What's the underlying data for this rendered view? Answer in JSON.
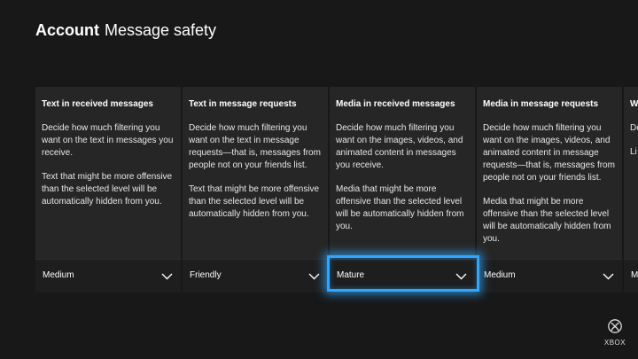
{
  "header": {
    "section": "Account",
    "title": "Message safety"
  },
  "cards": [
    {
      "title": "Text in received messages",
      "desc1": "Decide how much filtering you want on the text in messages you receive.",
      "desc2": "Text that might be more offensive than the selected level will be automatically hidden from you.",
      "value": "Medium"
    },
    {
      "title": "Text in message requests",
      "desc1": "Decide how much filtering you want on the text in message requests—that is, messages from people not on your friends list.",
      "desc2": "Text that might be more offensive than the selected level will be automatically hidden from you.",
      "value": "Friendly"
    },
    {
      "title": "Media in received messages",
      "desc1": "Decide how much filtering you want on the images, videos, and animated content in messages you receive.",
      "desc2": "Media that might be more offensive than the selected level will be automatically hidden from you.",
      "value": "Mature"
    },
    {
      "title": "Media in message requests",
      "desc1": "Decide how much filtering you want on the images, videos, and animated content in message requests—that is, messages from people not on your friends list.",
      "desc2": "Media that might be more offensive than the selected level will be automatically hidden from you.",
      "value": "Medium"
    },
    {
      "title": "W",
      "desc1": "De",
      "desc2": "Li th",
      "value": "M"
    }
  ],
  "focused_card_index": 2,
  "accent_color": "#2ea6ff",
  "brand": {
    "icon": "xbox-logo-icon",
    "label": "XBOX"
  }
}
